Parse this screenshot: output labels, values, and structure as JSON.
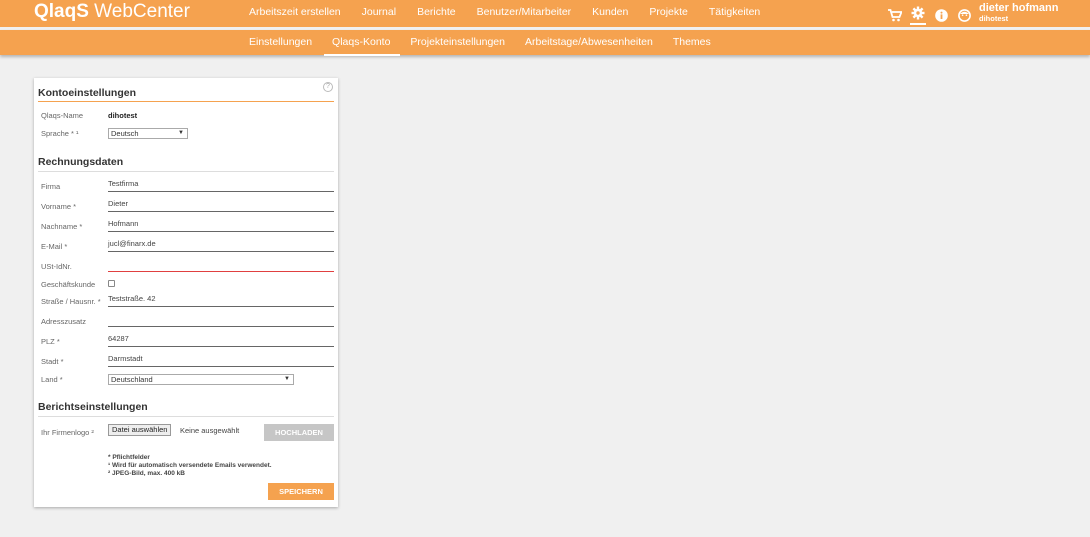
{
  "app": {
    "brand_bold": "QlaqS",
    "brand_rest": " WebCenter"
  },
  "topnav": [
    "Arbeitszeit erstellen",
    "Journal",
    "Berichte",
    "Benutzer/Mitarbeiter",
    "Kunden",
    "Projekte",
    "Tätigkeiten"
  ],
  "user": {
    "name": "dieter hofmann",
    "login": "dihotest"
  },
  "subnav": [
    "Einstellungen",
    "Qlaqs-Konto",
    "Projekteinstellungen",
    "Arbeitstage/Abwesenheiten",
    "Themes"
  ],
  "help_label": "?",
  "account": {
    "title": "Kontoeinstellungen",
    "name_label": "Qlaqs-Name",
    "name_value": "dihotest",
    "language_label": "Sprache * ¹",
    "language_value": "Deutsch"
  },
  "billing": {
    "title": "Rechnungsdaten",
    "company_label": "Firma",
    "company_value": "Testfirma",
    "firstname_label": "Vorname *",
    "firstname_value": "Dieter",
    "lastname_label": "Nachname *",
    "lastname_value": "Hofmann",
    "email_label": "E-Mail *",
    "email_value": "jucl@finarx.de",
    "vat_label": "USt-IdNr.",
    "vat_value": "",
    "business_label": "Geschäftskunde",
    "street_label": "Straße / Hausnr. *",
    "street_value": "Teststraße. 42",
    "addr2_label": "Adresszusatz",
    "addr2_value": "",
    "zip_label": "PLZ *",
    "zip_value": "64287",
    "city_label": "Stadt *",
    "city_value": "Darmstadt",
    "country_label": "Land *",
    "country_value": "Deutschland"
  },
  "report": {
    "title": "Berichtseinstellungen",
    "logo_label": "Ihr Firmenlogo ²",
    "file_button": "Datei auswählen",
    "no_file": "Keine ausgewählt",
    "upload_button": "HOCHLADEN"
  },
  "notes": [
    "* Pflichtfelder",
    "¹ Wird für automatisch versendete Emails verwendet.",
    "² JPEG-Bild, max. 400 kB"
  ],
  "save_button": "SPEICHERN",
  "colors": {
    "accent": "#f5a24f",
    "error": "#e04040"
  },
  "icons": [
    "cart-icon",
    "gear-icon",
    "info-icon",
    "user-face-icon"
  ]
}
